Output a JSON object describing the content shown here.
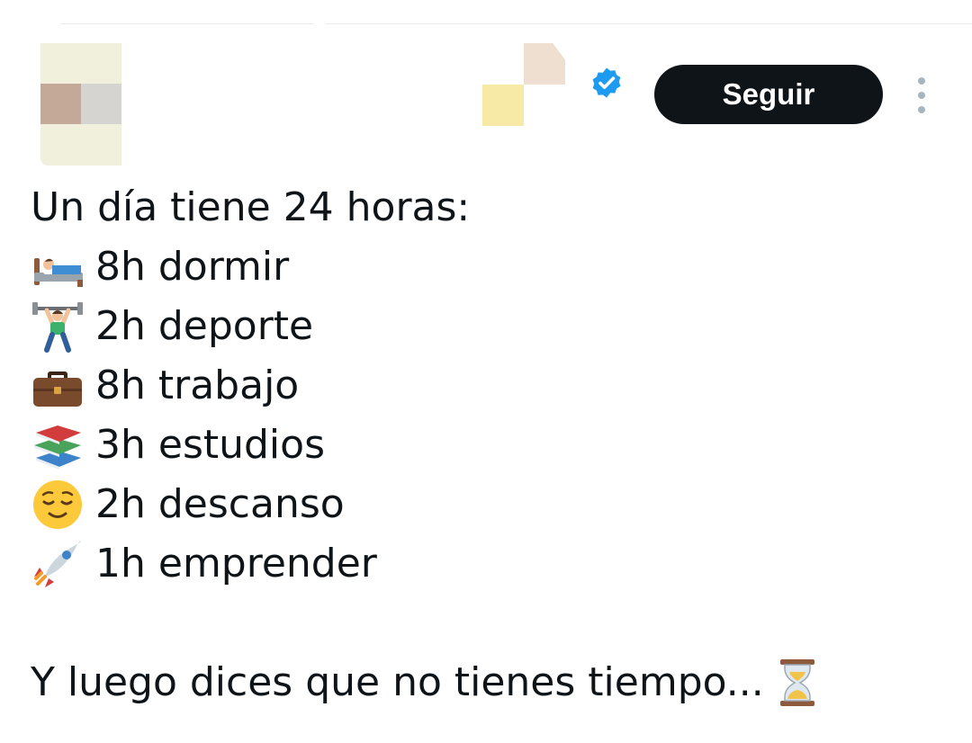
{
  "tweet": {
    "follow_label": "Seguir",
    "text_intro": "Un día tiene 24 horas:",
    "schedule": [
      {
        "icon": "sleeping-bed-icon",
        "text": "8h dormir"
      },
      {
        "icon": "weightlifter-icon",
        "text": "2h deporte"
      },
      {
        "icon": "briefcase-icon",
        "text": "8h trabajo"
      },
      {
        "icon": "books-icon",
        "text": "3h estudios"
      },
      {
        "icon": "relieved-face-icon",
        "text": "2h descanso"
      },
      {
        "icon": "rocket-icon",
        "text": "1h emprender"
      }
    ],
    "closing_text": "Y luego dices que no tienes tiempo...",
    "closing_icon": "hourglass-icon"
  },
  "colors": {
    "text": "#0f1419",
    "button_bg": "#0f1419",
    "button_text": "#ffffff",
    "verified_badge": "#1d9bf0",
    "more_dots": "#a9b6c2"
  }
}
